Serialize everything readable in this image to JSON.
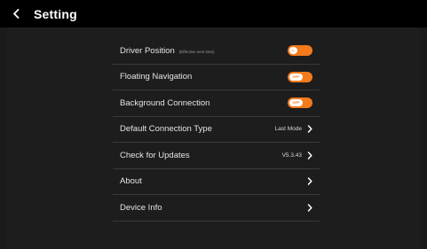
{
  "header": {
    "title": "Setting",
    "back_icon": "chevron-left-icon"
  },
  "colors": {
    "header_bg": "#000000",
    "panel_bg": "#1d1d1d",
    "accent": "#f47a1c",
    "divider": "#3a3a3a"
  },
  "settings": [
    {
      "label": "Driver Position",
      "sublabel": "(Effective next time)",
      "control": "toggle",
      "toggle_text": "L"
    },
    {
      "label": "Floating Navigation",
      "control": "toggle",
      "toggle_text": "OFF"
    },
    {
      "label": "Background Connection",
      "control": "toggle",
      "toggle_text": "OFF"
    },
    {
      "label": "Default Connection Type",
      "control": "link",
      "value": "Last Mode"
    },
    {
      "label": "Check for Updates",
      "control": "link",
      "value": "V5.3.43"
    },
    {
      "label": "About",
      "control": "link"
    },
    {
      "label": "Device Info",
      "control": "link"
    }
  ]
}
